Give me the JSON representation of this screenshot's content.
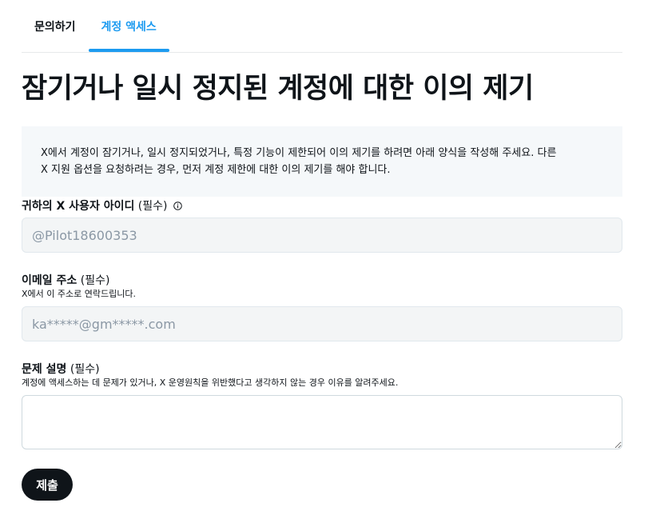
{
  "tabs": [
    {
      "label": "문의하기"
    },
    {
      "label": "계정 액세스"
    }
  ],
  "page_title": "잠기거나 일시 정지된 계정에 대한 이의 제기",
  "notice": {
    "line1": "X에서 계정이 잠기거나, 일시 정지되었거나, 특정 기능이 제한되어 이의 제기를 하려면 아래 양식을 작성해 주세요. 다른",
    "line2": "X 지원 옵션을 요청하려는 경우, 먼저 계정 제한에 대한 이의 제기를 해야 합니다."
  },
  "fields": {
    "user_id": {
      "label": "귀하의 X 사용자 아이디",
      "required": "(필수)",
      "icon": "info-icon",
      "placeholder": "@Pilot18600353"
    },
    "email": {
      "label": "이메일 주소",
      "required": "(필수)",
      "help": "X에서 이 주소로 연락드립니다.",
      "placeholder": "ka*****@gm*****.com"
    },
    "description": {
      "label": "문제 설명",
      "required": "(필수)",
      "help": "계정에 액세스하는 데 문제가 있거나, X 운영원칙을 위반했다고 생각하지 않는 경우 이유를 알려주세요.",
      "value": ""
    }
  },
  "submit_label": "제출",
  "colors": {
    "accent": "#1d9bf0",
    "text": "#0f1419",
    "notice_bg": "#f5f8fa",
    "button_bg": "#0f1419"
  }
}
